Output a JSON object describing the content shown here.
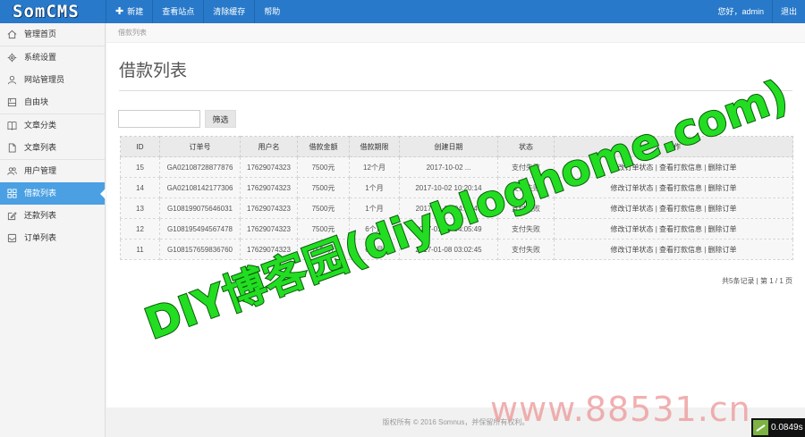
{
  "header": {
    "logo": "SomCMS",
    "nav": [
      "新建",
      "查看站点",
      "清除缓存",
      "帮助"
    ],
    "greeting": "您好，admin",
    "logout": "退出"
  },
  "sidebar": {
    "groups": [
      [
        {
          "label": "管理首页",
          "icon": "home-icon"
        }
      ],
      [
        {
          "label": "系统设置",
          "icon": "gear-icon"
        },
        {
          "label": "网站管理员",
          "icon": "user-icon"
        },
        {
          "label": "自由块",
          "icon": "block-icon"
        }
      ],
      [
        {
          "label": "文章分类",
          "icon": "book-icon"
        },
        {
          "label": "文章列表",
          "icon": "file-icon"
        }
      ],
      [
        {
          "label": "用户管理",
          "icon": "users-icon"
        },
        {
          "label": "借款列表",
          "icon": "grid-icon",
          "active": true
        },
        {
          "label": "还款列表",
          "icon": "edit-icon"
        },
        {
          "label": "订单列表",
          "icon": "inbox-icon"
        }
      ]
    ]
  },
  "breadcrumb": "借款列表",
  "page_title": "借款列表",
  "search": {
    "value": "",
    "placeholder": ""
  },
  "filter_button": "筛选",
  "table": {
    "headers": [
      "ID",
      "订单号",
      "用户名",
      "借款金额",
      "借款期限",
      "创建日期",
      "状态",
      "操作"
    ],
    "rows": [
      [
        "15",
        "GA02108728877876",
        "17629074323",
        "7500元",
        "12个月",
        "2017-10-02 ...",
        "支付失败"
      ],
      [
        "14",
        "GA02108142177306",
        "17629074323",
        "7500元",
        "1个月",
        "2017-10-02 10:20:14",
        "支付失败"
      ],
      [
        "13",
        "G108199075646031",
        "17629074323",
        "7500元",
        "1个月",
        "2017-01-08 04:11:47",
        "支付失败"
      ],
      [
        "12",
        "G108195494567478",
        "17629074323",
        "7500元",
        "6个月",
        "2017-01-08 04:05:49",
        "支付失败"
      ],
      [
        "11",
        "G108157659836760",
        "17629074323",
        "7500元",
        "6个月",
        "2017-01-08 03:02:45",
        "支付失败"
      ]
    ],
    "ops": [
      "修改订单状态",
      "查看打款信息",
      "删除订单"
    ]
  },
  "pager": "共5条记录 | 第 1 / 1 页",
  "footer": "版权所有 © 2016 Somnus，并保留所有权利。",
  "watermark_diy": "DIY博客园(diybloghome.com)",
  "watermark_num": "www.88531.cn",
  "timer": "0.0849s",
  "colors": {
    "topbar": "#2879c9",
    "active": "#4aa0e3",
    "watermark_green": "#22dd22"
  }
}
